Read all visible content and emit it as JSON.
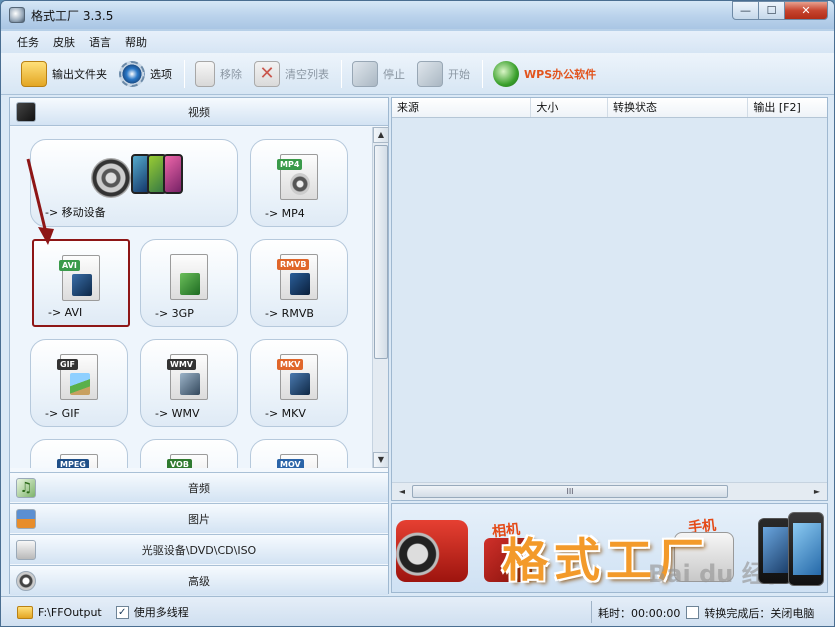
{
  "window": {
    "title": "格式工厂 3.3.5",
    "controls": [
      "min",
      "max",
      "close"
    ]
  },
  "menu": {
    "items": [
      "任务",
      "皮肤",
      "语言",
      "帮助"
    ]
  },
  "toolbar": {
    "output_folder": "输出文件夹",
    "options": "选项",
    "remove": "移除",
    "clear_list": "清空列表",
    "stop": "停止",
    "start": "开始",
    "wps": "WPS办公软件"
  },
  "left_panel": {
    "video_header": "视频",
    "tiles": [
      {
        "label": "-> 移动设备",
        "badge": ""
      },
      {
        "label": "-> MP4",
        "badge": "MP4",
        "badge_color": "#3a9a4a"
      },
      {
        "label": "-> AVI",
        "badge": "AVI",
        "badge_color": "#3a9a4a",
        "selected": true
      },
      {
        "label": "-> 3GP",
        "badge": "",
        "badge_color": "#3a9a4a"
      },
      {
        "label": "-> RMVB",
        "badge": "RMVB",
        "badge_color": "#e0662a"
      },
      {
        "label": "-> GIF",
        "badge": "GIF",
        "badge_color": "#333333"
      },
      {
        "label": "-> WMV",
        "badge": "WMV",
        "badge_color": "#333333"
      },
      {
        "label": "-> MKV",
        "badge": "MKV",
        "badge_color": "#e0662a"
      },
      {
        "label": "",
        "badge": "MPEG",
        "badge_color": "#1f4f88"
      },
      {
        "label": "",
        "badge": "VOB",
        "badge_color": "#2f7a2f"
      },
      {
        "label": "",
        "badge": "MOV",
        "badge_color": "#2a64a8"
      }
    ],
    "categories": {
      "audio": "音频",
      "image": "图片",
      "optical": "光驱设备\\DVD\\CD\\ISO",
      "advanced": "高级"
    }
  },
  "file_list": {
    "columns": [
      "来源",
      "大小",
      "转换状态",
      "输出 [F2]"
    ],
    "hscroll_grip": "III"
  },
  "banner": {
    "brand": "格式工厂",
    "tag_camera": "相机",
    "tag_phone": "手机",
    "watermark": "Bai du 经验"
  },
  "statusbar": {
    "output_path": "F:\\FFOutput",
    "multithread": "使用多线程",
    "multithread_checked": true,
    "elapsed": "耗时：00:00:00",
    "after_convert": "转换完成后：关闭电脑",
    "after_convert_checked": false
  }
}
